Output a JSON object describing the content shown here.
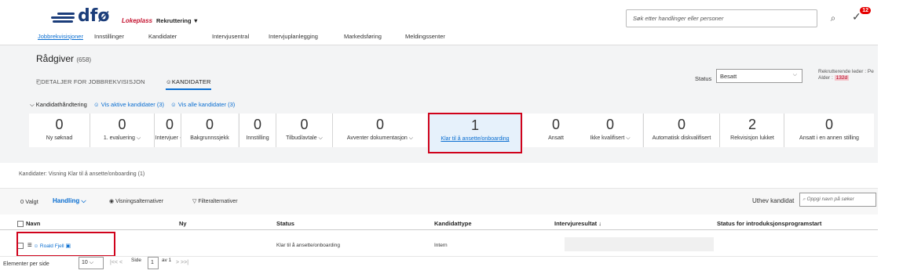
{
  "brand": {
    "logo_text": "dfø",
    "logo_sub": "Lokeplass"
  },
  "header": {
    "recruit_menu": "Rekruttering ▼",
    "nav": [
      "Jobbrekvisisjoner",
      "Innstillinger",
      "Kandidater",
      "Intervjusentral",
      "Intervjuplanlegging",
      "Markedsføring",
      "Meldingssenter"
    ],
    "search_placeholder": "Søk etter handlinger eller personer",
    "notification_count": "12"
  },
  "page": {
    "title": "Rådgiver",
    "count": "(658)",
    "tabs": [
      "DETALJER FOR JOBBREKVISISJON",
      "KANDIDATER"
    ],
    "status_label": "Status",
    "status_value": "Besatt",
    "recruiter_label": "Rekrutterende leder : Pe",
    "age_label": "Alder :",
    "age_value": "132d"
  },
  "kandidat": {
    "heading": "Kandidathåndtering",
    "link_active": "Vis aktive kandidater (3)",
    "link_all": "Vis alle kandidater (3)"
  },
  "pipeline": [
    {
      "num": "0",
      "label": "Ny søknad"
    },
    {
      "num": "0",
      "label": "1. evaluering ⌵"
    },
    {
      "num": "0",
      "label": "Intervjuer ⌵"
    },
    {
      "num": "0",
      "label": "Bakgrunnssjekk"
    },
    {
      "num": "0",
      "label": "Innstilling"
    },
    {
      "num": "0",
      "label": "Tilbud/avtale ⌵"
    },
    {
      "num": "0",
      "label": "Avventer dokumentasjon ⌵"
    },
    {
      "num": "1",
      "label": "Klar til å ansette/onboarding"
    },
    {
      "num": "0",
      "label": "Ansatt"
    },
    {
      "num": "0",
      "label": "Ikke kvalifisert ⌵"
    },
    {
      "num": "0",
      "label": "Automatisk diskvalifisert"
    },
    {
      "num": "2",
      "label": "Rekvisisjon lukket"
    },
    {
      "num": "0",
      "label": "Ansatt i en annen stilling"
    }
  ],
  "list": {
    "view_text": "Kandidater: Visning Klar til å ansette/onboarding (1)",
    "selected": "0 Valgt",
    "handling": "Handling ⌵",
    "visning": "Visningsalternativer",
    "filter": "Filteralternativer",
    "highlight_label": "Uthev kandidat",
    "highlight_placeholder": "Oppgi navn på søker",
    "columns": [
      "Navn",
      "Ny",
      "Status",
      "Kandidattype",
      "Intervjuresultat ↓",
      "Status for introduksjonsprogramstart"
    ],
    "rows": [
      {
        "name": "Roald Fjell",
        "ny": "",
        "status": "Klar til å ansette/onboarding",
        "type": "Intern",
        "result": "",
        "intro": ""
      }
    ]
  },
  "footer": {
    "per_page_label": "Elementer per side",
    "per_page": "10",
    "side_label": "Side",
    "page": "1",
    "of_label": "av 1"
  }
}
